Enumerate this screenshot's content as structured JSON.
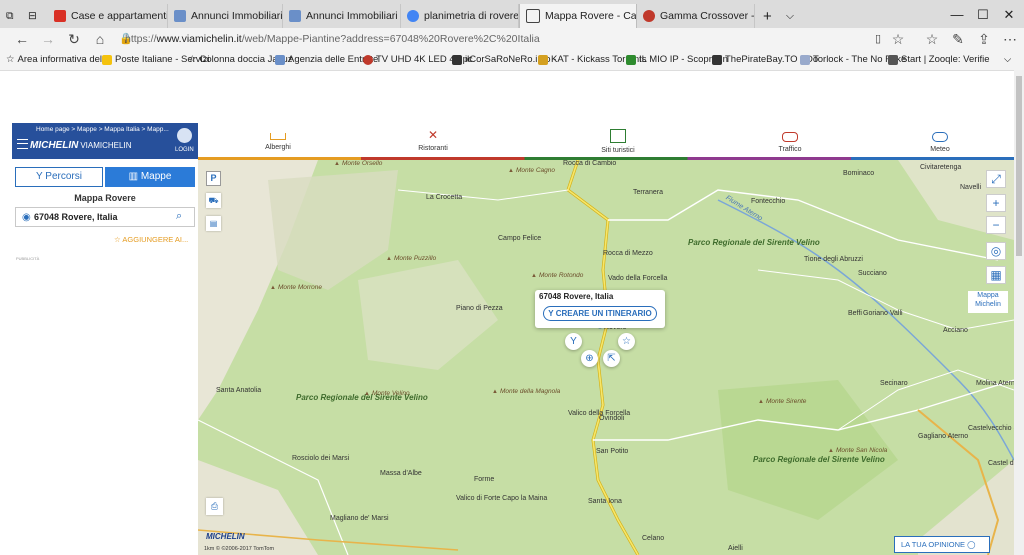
{
  "tabs": [
    {
      "label": "Case e appartamenti in vend",
      "color": "#d93025"
    },
    {
      "label": "Annunci Immobiliari - Cercas",
      "color": "#6a8fc8"
    },
    {
      "label": "Annunci Immobiliari - Cercas",
      "color": "#6a8fc8"
    },
    {
      "label": "planimetria di rovere aquila",
      "color": "#4285f4"
    },
    {
      "label": "Mappa Rovere - Cartina",
      "color": "#444444"
    },
    {
      "label": "Gamma Crossover - Offers a",
      "color": "#c0392b"
    }
  ],
  "address": {
    "url_prefix": "https://",
    "url_domain": "www.viamichelin.it",
    "url_path": "/web/Mappe-Piantine?address=67048%20Rovere%2C%20Italia"
  },
  "favorites": [
    "Area informativa dell'",
    "Poste Italiane - Servizi",
    "Colonna doccia Jacuz",
    "Agenzia delle Entrate",
    "TV UHD 4K LED 49 pc",
    "ilCorSaRoNeRo.info -",
    "KAT - Kickass Torrents",
    "IL MIO IP - Scopri l'in",
    "ThePirateBay.TO - Do",
    "Torlock - The No Fake",
    "Start | Zooqle: Verifie"
  ],
  "michelin": {
    "breadcrumb": "Home page > Mappe > Mappa Italia > Mapp...",
    "brand": "MICHELIN",
    "brand_suffix": "VIAMICHELIN",
    "login": "LOGIN"
  },
  "categories": [
    {
      "label": "Alberghi",
      "color": "#e59c22"
    },
    {
      "label": "Ristoranti",
      "color": "#c0392b"
    },
    {
      "label": "Siti turistici",
      "color": "#2e7d32"
    },
    {
      "label": "Traffico",
      "color": "#c0392b"
    },
    {
      "label": "Meteo",
      "color": "#2a6ebb"
    }
  ],
  "sidebar": {
    "percorsi": "Percorsi",
    "mappe": "Mappe",
    "title": "Mappa Rovere",
    "search_value": "67048 Rovere, Italia",
    "add_favorite": "AGGIUNGERE AI...",
    "ad_label": "PUBBLICITÀ"
  },
  "popup": {
    "title": "67048 Rovere, Italia",
    "button": "CREARE UN ITINERARIO"
  },
  "map_labels": {
    "places": [
      "Ovindoli",
      "Rocca di Cambio",
      "Terranera",
      "Rocca di Mezzo",
      "Fontecchio",
      "Campo Felice",
      "Piano di Pezza",
      "Santa Anatolia",
      "Rosciolo dei Marsi",
      "Massa d'Albe",
      "Forme",
      "Santa Iona",
      "Celano",
      "Aielli",
      "Magliano de' Marsi",
      "San Potito",
      "Valico della Forcella",
      "Vado della Forcella",
      "Secinaro",
      "Molina Aterno",
      "Castelvecchio Subequo",
      "Gagliano Aterno",
      "Castel di Ieri",
      "Acciano",
      "Goriano Valli",
      "Bominaco",
      "Civitaretenga",
      "Navelli",
      "Succiano",
      "Beffi",
      "Tione degli Abruzzi",
      "Valico di Forte Capo la Maina",
      "La Crocetta",
      "Rovere"
    ],
    "parks": [
      "Parco Regionale del Sirente Velino",
      "Parco Regionale del Sirente Velino",
      "Parco Regionale del Sirente Velino"
    ],
    "mountains": [
      "Monte Rotondo",
      "Monte Cagno",
      "Monte Puzzillo",
      "Monte Morrone",
      "Monte Velino",
      "Monte della Magnola",
      "Monte Sirente",
      "Monte San Nicola",
      "Monte Orsello"
    ],
    "river": "Fiume Aterno"
  },
  "map_ui": {
    "mappa_michelin": "Mappa Michelin",
    "tua_opinione": "LA TUA OPINIONE",
    "scale": "1km   © ©2006-2017 TomTom"
  }
}
